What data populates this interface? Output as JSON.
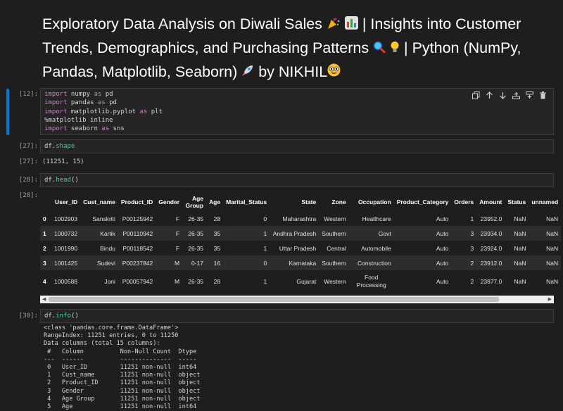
{
  "title": {
    "part1": "Exploratory Data Analysis on Diwali Sales ",
    "part2": " | Insights into Customer Trends, Demographics, and Purchasing Patterns ",
    "part3": " | Python (NumPy, Pandas, Matplotlib, Seaborn) ",
    "part4": " by NIKHIL"
  },
  "cells": {
    "c12": {
      "prompt": "[12]:",
      "lines": [
        {
          "kw": "import",
          "rest": " numpy ",
          "kw2": "as",
          "rest2": " pd"
        },
        {
          "kw": "import",
          "rest": " pandas ",
          "kw2": "as",
          "rest2": " pd"
        },
        {
          "kw": "import",
          "rest": " matplotlib.pyplot ",
          "kw2": "as",
          "rest2": " plt"
        },
        {
          "kw": "",
          "rest": "%matplotlib inline",
          "kw2": "",
          "rest2": ""
        },
        {
          "kw": "import",
          "rest": " seaborn ",
          "kw2": "as",
          "rest2": " sns"
        }
      ]
    },
    "c27": {
      "prompt": "[27]:",
      "obj": "df.",
      "attr": "shape",
      "out_prompt": "[27]:",
      "output": "(11251, 15)"
    },
    "c28": {
      "prompt": "[28]:",
      "obj": "df.",
      "attr": "head",
      "call": "()",
      "out_prompt": "[28]:"
    },
    "c30": {
      "prompt": "[30]:",
      "obj": "df.",
      "attr": "info",
      "call": "()"
    }
  },
  "toolbar": [
    "copy-icon",
    "arrow-up-icon",
    "arrow-down-icon",
    "insert-below-icon",
    "split-cell-icon",
    "delete-icon"
  ],
  "dataframe": {
    "columns": [
      "",
      "User_ID",
      "Cust_name",
      "Product_ID",
      "Gender",
      "Age Group",
      "Age",
      "Marital_Status",
      "State",
      "Zone",
      "Occupation",
      "Product_Category",
      "Orders",
      "Amount",
      "Status",
      "unnamed"
    ],
    "rows": [
      [
        "0",
        "1002903",
        "Sanskriti",
        "P00125942",
        "F",
        "26-35",
        "28",
        "0",
        "Maharashtra",
        "Western",
        "Healthcare",
        "Auto",
        "1",
        "23952.0",
        "NaN",
        "NaN"
      ],
      [
        "1",
        "1000732",
        "Kartik",
        "P00110942",
        "F",
        "26-35",
        "35",
        "1",
        "Andhra Pradesh",
        "Southern",
        "Govt",
        "Auto",
        "3",
        "23934.0",
        "NaN",
        "NaN"
      ],
      [
        "2",
        "1001990",
        "Bindu",
        "P00118542",
        "F",
        "26-35",
        "35",
        "1",
        "Uttar Pradesh",
        "Central",
        "Automobile",
        "Auto",
        "3",
        "23924.0",
        "NaN",
        "NaN"
      ],
      [
        "3",
        "1001425",
        "Sudevi",
        "P00237842",
        "M",
        "0-17",
        "16",
        "0",
        "Karnataka",
        "Southern",
        "Construction",
        "Auto",
        "2",
        "23912.0",
        "NaN",
        "NaN"
      ],
      [
        "4",
        "1000588",
        "Joni",
        "P00057942",
        "M",
        "26-35",
        "28",
        "1",
        "Gujarat",
        "Western",
        "Food Processing",
        "Auto",
        "2",
        "23877.0",
        "NaN",
        "NaN"
      ]
    ]
  },
  "info_output": "<class 'pandas.core.frame.DataFrame'>\nRangeIndex: 11251 entries, 0 to 11250\nData columns (total 15 columns):\n #   Column          Non-Null Count  Dtype\n---  ------          --------------  -----\n 0   User_ID         11251 non-null  int64\n 1   Cust_name       11251 non-null  object\n 2   Product_ID      11251 non-null  object\n 3   Gender          11251 non-null  object\n 4   Age Group       11251 non-null  object\n 5   Age             11251 non-null  int64"
}
